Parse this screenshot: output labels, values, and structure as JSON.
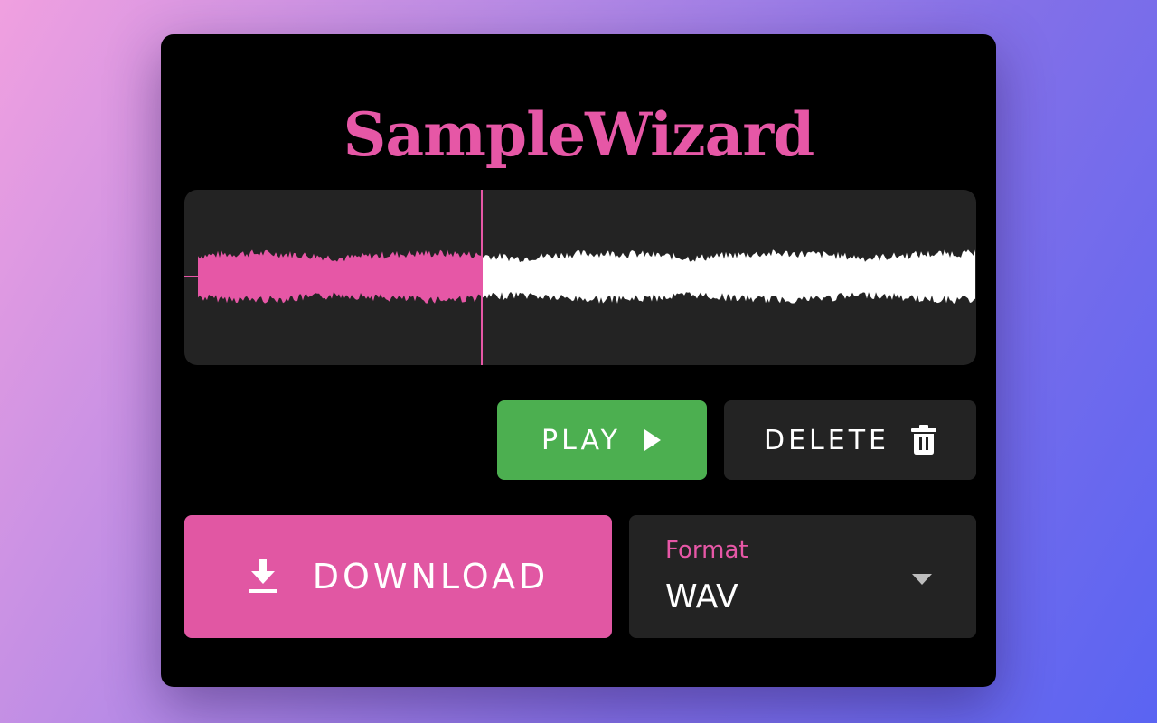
{
  "app": {
    "title": "SampleWizard"
  },
  "waveform": {
    "played_color": "#e657a6",
    "unplayed_color": "#ffffff",
    "panel_color": "#232323",
    "playhead_progress": 0.365
  },
  "controls": {
    "play_label": "PLAY",
    "play_icon": "play-triangle-icon",
    "delete_label": "DELETE",
    "delete_icon": "trash-icon",
    "download_label": "DOWNLOAD",
    "download_icon": "download-icon"
  },
  "format": {
    "label": "Format",
    "value": "WAV",
    "icon": "caret-down-icon"
  },
  "colors": {
    "accent": "#e157a3",
    "play": "#4caf50",
    "surface": "#232323",
    "card": "#000000"
  }
}
